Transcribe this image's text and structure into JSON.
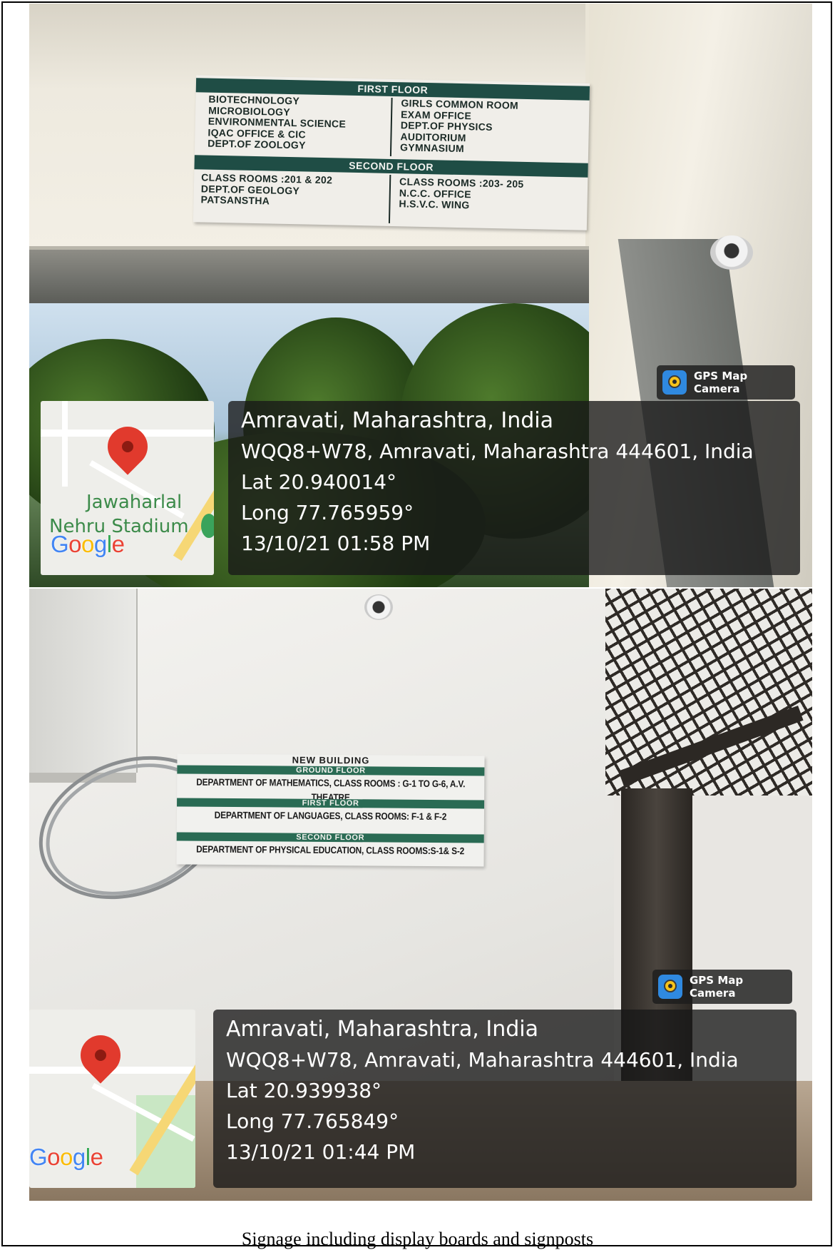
{
  "photo1": {
    "sign": {
      "band_top": "FIRST FLOOR",
      "left_top": [
        "BIOTECHNOLOGY",
        "MICROBIOLOGY",
        "ENVIRONMENTAL SCIENCE",
        "IQAC OFFICE & CIC",
        "DEPT.OF ZOOLOGY"
      ],
      "right_top": [
        "GIRLS COMMON ROOM",
        "EXAM OFFICE",
        "DEPT.OF PHYSICS",
        "AUDITORIUM",
        "GYMNASIUM"
      ],
      "band_bottom": "SECOND FLOOR",
      "left_bottom": [
        "CLASS ROOMS :201 & 202",
        "DEPT.OF GEOLOGY",
        "PATSANSTHA"
      ],
      "right_bottom": [
        "CLASS ROOMS :203- 205",
        "N.C.C. OFFICE",
        "H.S.V.C. WING"
      ]
    },
    "badge": "GPS Map Camera",
    "location": "Amravati, Maharashtra, India",
    "address": "WQQ8+W78, Amravati, Maharashtra 444601, India",
    "lat": "Lat 20.940014°",
    "long": "Long 77.765959°",
    "datetime": "13/10/21 01:58 PM",
    "map": {
      "place_line1": "Jawaharlal",
      "place_line2": "Nehru Stadium",
      "brand": "Google"
    }
  },
  "photo2": {
    "sign": {
      "title": "NEW BUILDING",
      "band1": "GROUND FLOOR",
      "row1": "DEPARTMENT OF MATHEMATICS, CLASS ROOMS : G-1 TO G-6, A.V. THEATRE",
      "band2": "FIRST FLOOR",
      "row2": "DEPARTMENT OF LANGUAGES, CLASS ROOMS: F-1 & F-2",
      "band3": "SECOND FLOOR",
      "row3": "DEPARTMENT OF PHYSICAL EDUCATION, CLASS ROOMS:S-1& S-2"
    },
    "badge": "GPS Map Camera",
    "location": "Amravati, Maharashtra, India",
    "address": "WQQ8+W78, Amravati, Maharashtra 444601, India",
    "lat": "Lat 20.939938°",
    "long": "Long 77.765849°",
    "datetime": "13/10/21 01:44 PM",
    "map": {
      "brand": "Google"
    }
  },
  "caption": "Signage including display boards and signposts",
  "colors": {
    "sign_green": "#1f4d45",
    "overlay": "#181818",
    "pin_red": "#e13a2d",
    "google_blue": "#4285f4"
  },
  "icons": [
    "gps-map-camera-icon",
    "map-pin-icon",
    "park-icon",
    "camera-dome-icon"
  ]
}
